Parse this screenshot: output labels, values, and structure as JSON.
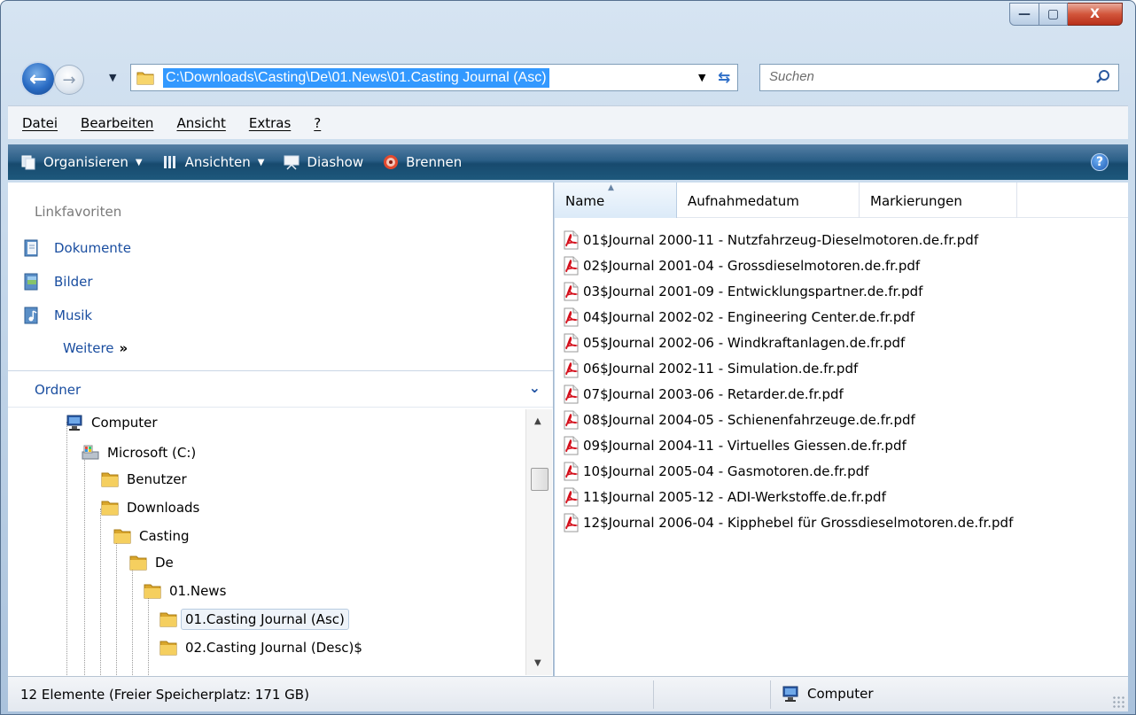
{
  "window": {
    "controls": {
      "minimize": "—",
      "maximize": "▢",
      "close": "X"
    }
  },
  "nav": {
    "address": "C:\\Downloads\\Casting\\De\\01.News\\01.Casting Journal (Asc)",
    "search_placeholder": "Suchen"
  },
  "menu": [
    "Datei",
    "Bearbeiten",
    "Ansicht",
    "Extras",
    "?"
  ],
  "toolbar": {
    "organize": "Organisieren",
    "views": "Ansichten",
    "slideshow": "Diashow",
    "burn": "Brennen",
    "help": "?"
  },
  "favorites": {
    "heading": "Linkfavoriten",
    "items": [
      {
        "label": "Dokumente",
        "icon": "documents-icon"
      },
      {
        "label": "Bilder",
        "icon": "pictures-icon"
      },
      {
        "label": "Musik",
        "icon": "music-icon"
      }
    ],
    "more": "Weitere",
    "more_arrows": "»"
  },
  "folders": {
    "heading": "Ordner",
    "tree": [
      {
        "label": "Computer",
        "icon": "computer-icon",
        "depth": 0
      },
      {
        "label": "Microsoft (C:)",
        "icon": "drive-icon",
        "depth": 1
      },
      {
        "label": "Benutzer",
        "icon": "folder-icon",
        "depth": 2
      },
      {
        "label": "Downloads",
        "icon": "folder-icon",
        "depth": 2
      },
      {
        "label": "Casting",
        "icon": "folder-icon",
        "depth": 3
      },
      {
        "label": "De",
        "icon": "folder-icon",
        "depth": 4
      },
      {
        "label": "01.News",
        "icon": "folder-icon",
        "depth": 5
      },
      {
        "label": "01.Casting Journal (Asc)",
        "icon": "folder-icon",
        "depth": 6,
        "selected": true
      },
      {
        "label": "02.Casting Journal (Desc)$",
        "icon": "folder-icon",
        "depth": 6
      }
    ]
  },
  "columns": [
    "Name",
    "Aufnahmedatum",
    "Markierungen",
    "»"
  ],
  "files": [
    "01$Journal 2000-11 - Nutzfahrzeug-Dieselmotoren.de.fr.pdf",
    "02$Journal 2001-04 - Grossdieselmotoren.de.fr.pdf",
    "03$Journal 2001-09 - Entwicklungspartner.de.fr.pdf",
    "04$Journal 2002-02 - Engineering Center.de.fr.pdf",
    "05$Journal 2002-06 - Windkraftanlagen.de.fr.pdf",
    "06$Journal 2002-11 - Simulation.de.fr.pdf",
    "07$Journal 2003-06 - Retarder.de.fr.pdf",
    "08$Journal 2004-05 - Schienenfahrzeuge.de.fr.pdf",
    "09$Journal 2004-11 - Virtuelles Giessen.de.fr.pdf",
    "10$Journal 2005-04 - Gasmotoren.de.fr.pdf",
    "11$Journal 2005-12 - ADI-Werkstoffe.de.fr.pdf",
    "12$Journal 2006-04 - Kipphebel für Grossdieselmotoren.de.fr.pdf"
  ],
  "status": {
    "items": "12 Elemente (Freier Speicherplatz: 171 GB)",
    "location": "Computer"
  },
  "colors": {
    "selection": "#3399ff",
    "link": "#1a4ea0",
    "toolbar": "#2b5f87",
    "pdf_red": "#d4101c"
  }
}
